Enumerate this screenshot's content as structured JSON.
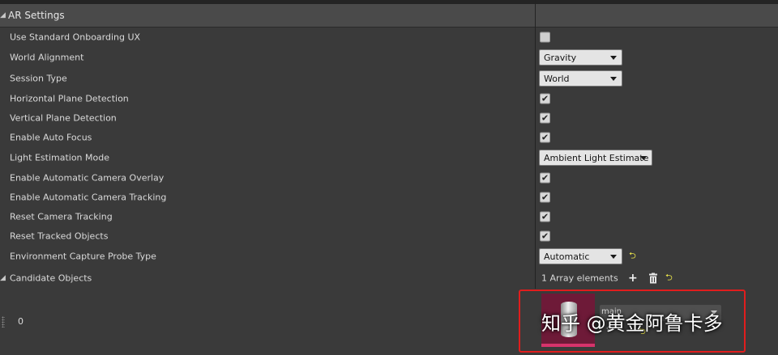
{
  "section": {
    "title": "AR Settings"
  },
  "rows": [
    {
      "label": "Use Standard Onboarding UX",
      "control": "checkbox",
      "checked": false
    },
    {
      "label": "World Alignment",
      "control": "dropdown",
      "value": "Gravity"
    },
    {
      "label": "Session Type",
      "control": "dropdown",
      "value": "World"
    },
    {
      "label": "Horizontal Plane Detection",
      "control": "checkbox",
      "checked": true
    },
    {
      "label": "Vertical Plane Detection",
      "control": "checkbox",
      "checked": true
    },
    {
      "label": "Enable Auto Focus",
      "control": "checkbox",
      "checked": true
    },
    {
      "label": "Light Estimation Mode",
      "control": "dropdown",
      "value": "Ambient Light Estimate"
    },
    {
      "label": "Enable Automatic Camera Overlay",
      "control": "checkbox",
      "checked": true
    },
    {
      "label": "Enable Automatic Camera Tracking",
      "control": "checkbox",
      "checked": true
    },
    {
      "label": "Reset Camera Tracking",
      "control": "checkbox",
      "checked": true
    },
    {
      "label": "Reset Tracked Objects",
      "control": "checkbox",
      "checked": true
    },
    {
      "label": "Environment Capture Probe Type",
      "control": "dropdown",
      "value": "Automatic"
    }
  ],
  "candidate": {
    "label": "Candidate Objects",
    "array_info": "1 Array elements",
    "entry_index": "0",
    "asset_name": "main"
  },
  "watermark": "知乎 @黄金阿鲁卡多",
  "icons": {
    "check": "checkmark-icon",
    "reset": "reset-to-default-icon",
    "add": "plus-icon",
    "delete": "trash-icon"
  },
  "colors": {
    "highlight": "#e01d1d",
    "reset_arrow": "#e8e24a",
    "thumbnail_bg": "#6e1a38"
  }
}
